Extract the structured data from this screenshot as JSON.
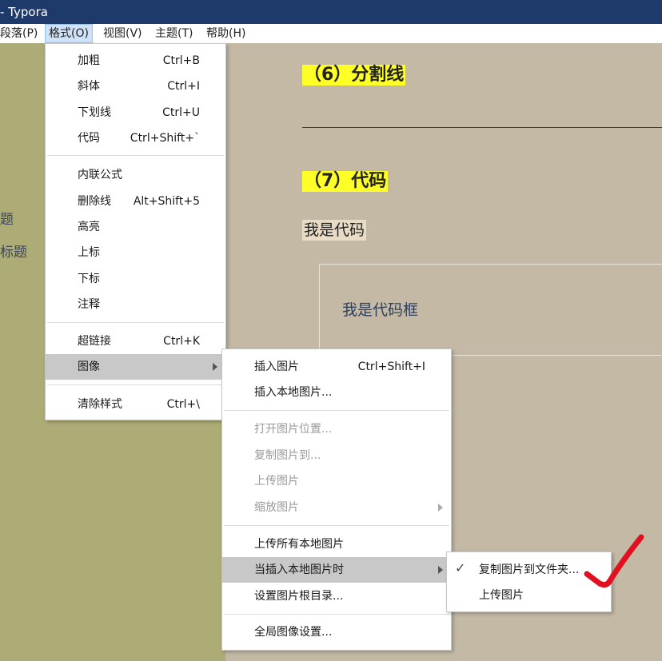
{
  "window": {
    "title": "- Typora"
  },
  "menubar": {
    "items": [
      {
        "label": "段落(P)"
      },
      {
        "label": "格式(O)"
      },
      {
        "label": "视图(V)"
      },
      {
        "label": "主题(T)"
      },
      {
        "label": "帮助(H)"
      }
    ]
  },
  "sidebar": {
    "outline_partial": [
      "题",
      "标题"
    ]
  },
  "editor": {
    "heading6": "（6）分割线",
    "heading7": "（7）代码",
    "inline_code": "我是代码",
    "code_block": "我是代码框"
  },
  "format_menu": {
    "items": [
      {
        "label": "加粗",
        "shortcut": "Ctrl+B"
      },
      {
        "label": "斜体",
        "shortcut": "Ctrl+I"
      },
      {
        "label": "下划线",
        "shortcut": "Ctrl+U"
      },
      {
        "label": "代码",
        "shortcut": "Ctrl+Shift+`"
      },
      {
        "label": "内联公式",
        "shortcut": ""
      },
      {
        "label": "删除线",
        "shortcut": "Alt+Shift+5"
      },
      {
        "label": "高亮",
        "shortcut": ""
      },
      {
        "label": "上标",
        "shortcut": ""
      },
      {
        "label": "下标",
        "shortcut": ""
      },
      {
        "label": "注释",
        "shortcut": ""
      },
      {
        "label": "超链接",
        "shortcut": "Ctrl+K"
      },
      {
        "label": "图像",
        "shortcut": ""
      },
      {
        "label": "清除样式",
        "shortcut": "Ctrl+\\"
      }
    ]
  },
  "image_menu": {
    "items": [
      {
        "label": "插入图片",
        "shortcut": "Ctrl+Shift+I"
      },
      {
        "label": "插入本地图片..."
      },
      {
        "label": "打开图片位置..."
      },
      {
        "label": "复制图片到..."
      },
      {
        "label": "上传图片"
      },
      {
        "label": "缩放图片"
      },
      {
        "label": "上传所有本地图片"
      },
      {
        "label": "当插入本地图片时"
      },
      {
        "label": "设置图片根目录..."
      },
      {
        "label": "全局图像设置..."
      }
    ]
  },
  "insert_local_menu": {
    "items": [
      {
        "label": "复制图片到文件夹...",
        "checked": true
      },
      {
        "label": "上传图片",
        "checked": false
      }
    ]
  },
  "colors": {
    "titlebar": "#1d3a6b",
    "sidebar": "#adab76",
    "editor_bg": "#c3b9a5",
    "heading_highlight": "#ffff28",
    "annotation_check": "#e01020"
  }
}
